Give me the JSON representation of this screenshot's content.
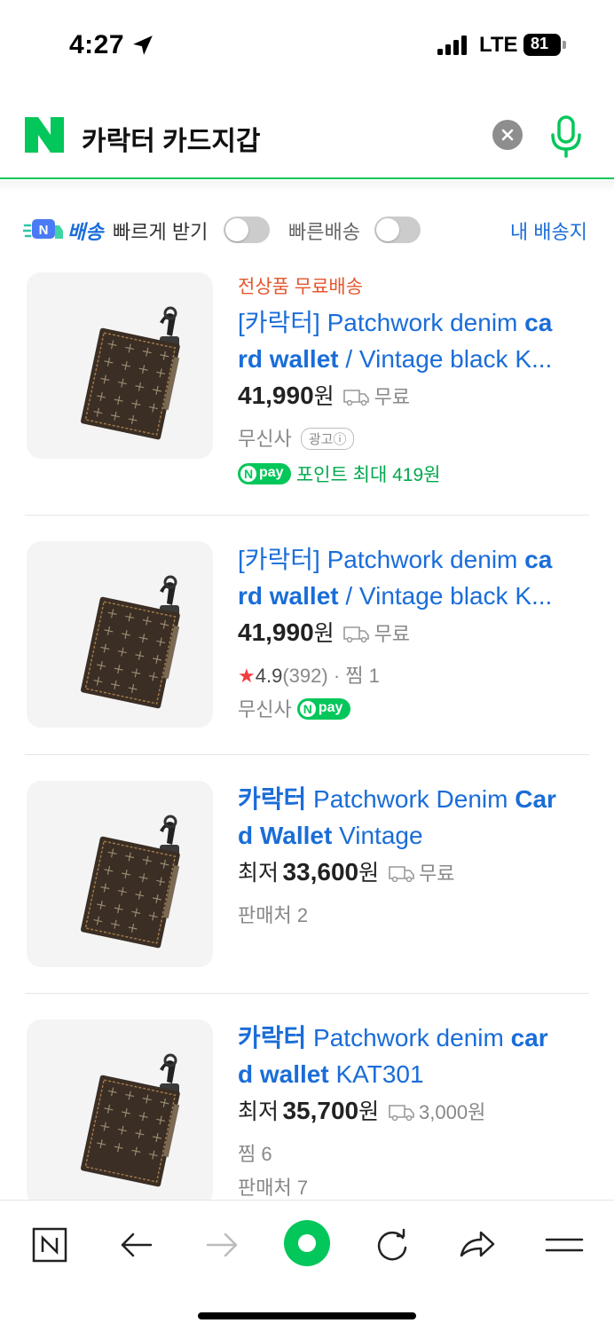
{
  "status_bar": {
    "time": "4:27",
    "network": "LTE",
    "battery": "81"
  },
  "search": {
    "query": "카락터 카드지갑"
  },
  "filters": {
    "delivery_badge": "N",
    "delivery_label": "배송",
    "fast_receive": "빠르게 받기",
    "fast_shipping": "빠른배송",
    "my_address": "내 배송지"
  },
  "products": [
    {
      "promo": "전상품 무료배송",
      "title_parts": [
        "[카락터] Patchwork denim ",
        "ca",
        "\nrd wallet",
        " / Vintage black K..."
      ],
      "price": "41,990",
      "won": "원",
      "shipping": "무료",
      "seller": "무신사",
      "ad": "광고ⓘ",
      "npay_point": "포인트 최대 419원"
    },
    {
      "title_parts": [
        "[카락터] Patchwork denim ",
        "ca",
        "\nrd wallet",
        " / Vintage black K..."
      ],
      "price": "41,990",
      "won": "원",
      "shipping": "무료",
      "rating": "4.9",
      "reviews": "(392)",
      "wish": "찜 1",
      "seller": "무신사"
    },
    {
      "title_bold": "카락터",
      "title_rest": " Patchwork Denim ",
      "title_bold2": "Car\nd Wallet",
      "title_rest2": " Vintage",
      "price_prefix": "최저",
      "price": "33,600",
      "won": "원",
      "shipping": "무료",
      "sellers": "판매처 2"
    },
    {
      "title_bold": "카락터",
      "title_rest": " Patchwork denim ",
      "title_bold2": "car\nd wallet",
      "title_rest2": " KAT301",
      "price_prefix": "최저",
      "price": "35,700",
      "won": "원",
      "shipping": "3,000원",
      "wish": "찜 6",
      "sellers": "판매처 7"
    }
  ],
  "npay_label": "pay",
  "npay_n": "N",
  "colors": {
    "naver_green": "#03c75a",
    "link_blue": "#1a6dd8",
    "promo_orange": "#e4572e"
  },
  "toolbar": {
    "icons": [
      "naver-home-icon",
      "back-icon",
      "forward-icon",
      "green-dot-icon",
      "reload-icon",
      "share-icon",
      "menu-icon"
    ]
  }
}
